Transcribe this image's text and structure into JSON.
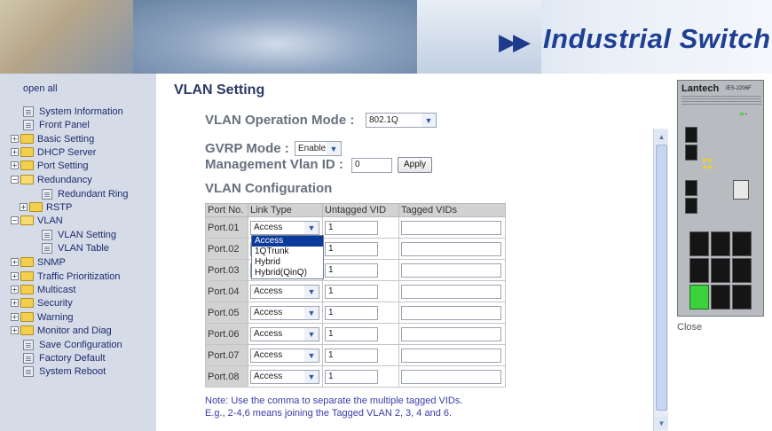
{
  "banner": {
    "arrows": "▶▶",
    "title": "Industrial Switch"
  },
  "nav": {
    "open_all": "open all",
    "items": [
      {
        "label": "System Information",
        "type": "page",
        "level": 1
      },
      {
        "label": "Front Panel",
        "type": "page",
        "level": 1
      },
      {
        "label": "Basic Setting",
        "type": "folder",
        "level": 0
      },
      {
        "label": "DHCP Server",
        "type": "folder",
        "level": 0
      },
      {
        "label": "Port Setting",
        "type": "folder",
        "level": 0
      },
      {
        "label": "Redundancy",
        "type": "folder-open",
        "level": 0
      },
      {
        "label": "Redundant Ring",
        "type": "page",
        "level": 2
      },
      {
        "label": "RSTP",
        "type": "folder",
        "level": 1
      },
      {
        "label": "VLAN",
        "type": "folder-open",
        "level": 0
      },
      {
        "label": "VLAN Setting",
        "type": "page",
        "level": 2
      },
      {
        "label": "VLAN Table",
        "type": "page",
        "level": 2
      },
      {
        "label": "SNMP",
        "type": "folder",
        "level": 0
      },
      {
        "label": "Traffic Prioritization",
        "type": "folder",
        "level": 0
      },
      {
        "label": "Multicast",
        "type": "folder",
        "level": 0
      },
      {
        "label": "Security",
        "type": "folder",
        "level": 0
      },
      {
        "label": "Warning",
        "type": "folder",
        "level": 0
      },
      {
        "label": "Monitor and Diag",
        "type": "folder",
        "level": 0
      },
      {
        "label": "Save Configuration",
        "type": "page",
        "level": 1
      },
      {
        "label": "Factory Default",
        "type": "page",
        "level": 1
      },
      {
        "label": "System Reboot",
        "type": "page",
        "level": 1
      }
    ]
  },
  "main": {
    "title": "VLAN Setting",
    "vlan_mode_label": "VLAN Operation Mode :",
    "vlan_mode_value": "802.1Q",
    "gvrp_label": "GVRP Mode :",
    "gvrp_value": "Enable",
    "mgmt_label": "Management Vlan ID :",
    "mgmt_value": "0",
    "apply_label": "Apply",
    "config_label": "VLAN Configuration",
    "table": {
      "headers": [
        "Port No.",
        "Link Type",
        "Untagged VID",
        "Tagged VIDs"
      ],
      "rows": [
        {
          "port": "Port.01",
          "link": "Access",
          "untagged": "1",
          "tagged": ""
        },
        {
          "port": "Port.02",
          "link": "Access",
          "untagged": "1",
          "tagged": ""
        },
        {
          "port": "Port.03",
          "link": "Access",
          "untagged": "1",
          "tagged": ""
        },
        {
          "port": "Port.04",
          "link": "Access",
          "untagged": "1",
          "tagged": ""
        },
        {
          "port": "Port.05",
          "link": "Access",
          "untagged": "1",
          "tagged": ""
        },
        {
          "port": "Port.06",
          "link": "Access",
          "untagged": "1",
          "tagged": ""
        },
        {
          "port": "Port.07",
          "link": "Access",
          "untagged": "1",
          "tagged": ""
        },
        {
          "port": "Port.08",
          "link": "Access",
          "untagged": "1",
          "tagged": ""
        }
      ]
    },
    "dropdown_options": [
      "Access",
      "1QTrunk",
      "Hybrid",
      "Hybrid(QinQ)"
    ],
    "note_line1": "Note: Use the comma to separate the multiple tagged VIDs.",
    "note_line2": "E.g., 2-4,6 means joining the Tagged VLAN 2, 3, 4 and 6."
  },
  "right": {
    "brand": "Lantech",
    "model": "IES-2206F",
    "close_label": "Close"
  }
}
